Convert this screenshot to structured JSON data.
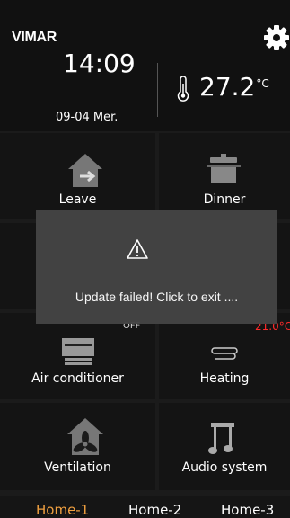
{
  "header": {
    "brand": "VIMAR",
    "time": "14:09",
    "date": "09-04 Mer.",
    "temperature": "27.2",
    "temperature_unit": "°C",
    "settings_icon": "gear-icon",
    "thermometer_icon": "thermometer-icon"
  },
  "tiles": [
    {
      "label": "Leave",
      "icon": "leave-home-icon"
    },
    {
      "label": "Dinner",
      "icon": "pot-icon"
    },
    {
      "label": "Air conditioner",
      "status": "OFF",
      "icon": "air-conditioner-icon"
    },
    {
      "label": "Heating",
      "status": "21.0°C",
      "icon": "heating-icon"
    },
    {
      "label": "Ventilation",
      "icon": "fan-home-icon"
    },
    {
      "label": "Audio system",
      "icon": "music-note-icon"
    }
  ],
  "tabs": [
    {
      "label": "Home-1",
      "active": true
    },
    {
      "label": "Home-2",
      "active": false
    },
    {
      "label": "Home-3",
      "active": false
    }
  ],
  "dialog": {
    "icon": "warning-icon",
    "message": "Update failed!  Click to exit ...."
  },
  "colors": {
    "active_tab": "#f0a040",
    "heating_status": "#ff2a2a",
    "dialog_bg": "#444444"
  }
}
